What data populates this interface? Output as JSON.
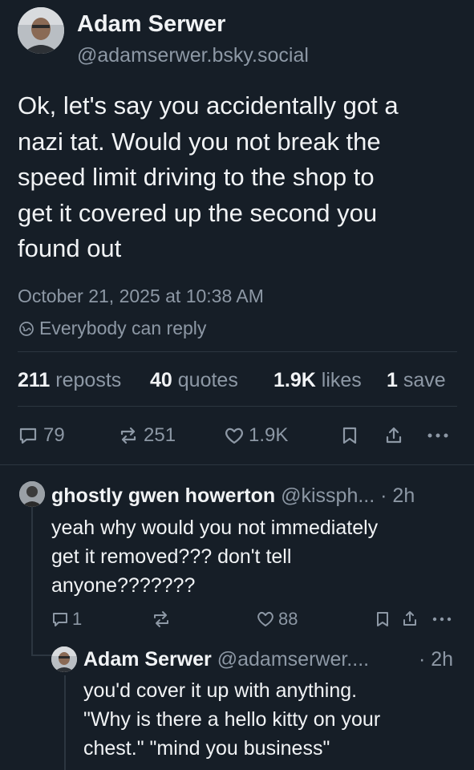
{
  "post": {
    "author_name": "Adam Serwer",
    "author_handle": "@adamserwer.bsky.social",
    "text_lines": [
      "Ok, let's say you accidentally got a",
      "nazi tat. Would you not break the",
      "speed limit driving to the shop to",
      "get it covered up the second you",
      "found out"
    ],
    "timestamp": "October 21, 2025 at 10:38 AM",
    "reply_setting": "Everybody can reply",
    "stats": {
      "reposts_count": "211",
      "reposts_label": "reposts",
      "quotes_count": "40",
      "quotes_label": "quotes",
      "likes_count": "1.9K",
      "likes_label": "likes",
      "saves_count": "1",
      "saves_label": "save"
    },
    "actions": {
      "replies": "79",
      "reposts": "251",
      "likes": "1.9K"
    }
  },
  "replies": [
    {
      "author_name": "ghostly gwen howerton",
      "author_handle": "@kissph...",
      "time": "· 2h",
      "text_lines": [
        "yeah why would you not immediately",
        "get it removed??? don't tell",
        "anyone???????"
      ],
      "reply_count": "1",
      "repost_count": "",
      "like_count": "88"
    },
    {
      "author_name": "Adam Serwer",
      "author_handle": "@adamserwer....",
      "time": "· 2h",
      "text_lines": [
        "you'd cover it up with anything.",
        "\"Why is there a hello kitty on your",
        "chest.\" \"mind you business\""
      ]
    }
  ],
  "icons": {
    "reply": "speech-bubble-icon",
    "repost": "repost-arrows-icon",
    "like": "heart-icon",
    "save": "bookmark-icon",
    "share": "share-upload-icon",
    "more": "ellipsis-icon",
    "reply_setting": "globe-icon"
  },
  "colors": {
    "background": "#161e27",
    "text": "#f1f3f5",
    "muted": "#8d98a5",
    "divider": "#2c3640"
  }
}
